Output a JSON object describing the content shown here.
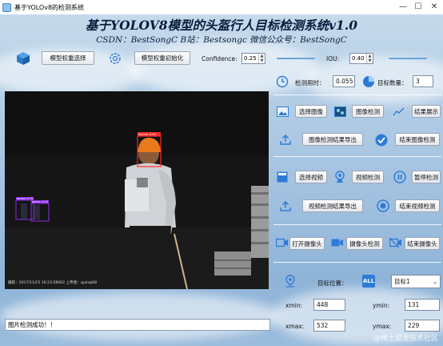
{
  "window": {
    "title": "基于YOLOv8的检测系统"
  },
  "header": {
    "title": "基于YOLOV8模型的头盔行人目标检测系统v1.0",
    "subtitle": "CSDN：BestSongC   B站：Bestsongc   微信公众号：BestSongC"
  },
  "toolbar": {
    "model_select_label": "模型权重选择",
    "model_init_label": "模型权重初始化",
    "confidence_label": "Confidence:",
    "confidence_value": "0.25",
    "iou_label": "IOU:",
    "iou_value": "0.40"
  },
  "stats": {
    "time_label": "检测用时：",
    "time_value": "0.055",
    "count_label": "目标数量：",
    "count_value": "3"
  },
  "image_panel": {
    "select_image": "选择图像",
    "detect_image": "图像检测",
    "show_result": "结果展示",
    "export_image": "图像检测结果导出",
    "stop_image": "结束图像检测"
  },
  "video_panel": {
    "select_video": "选择视频",
    "detect_video": "视频检测",
    "pause_detect": "暂停检测",
    "export_video": "视频检测结果导出",
    "stop_video": "结束视频检测"
  },
  "camera_panel": {
    "open_camera": "打开摄像头",
    "detect_camera": "摄像头检测",
    "stop_camera": "结束摄像头"
  },
  "target": {
    "position_label": "目标位置：",
    "selected": "目标1",
    "xmin_label": "xmin:",
    "xmin_value": "448",
    "ymin_label": "ymin:",
    "ymin_value": "131",
    "xmax_label": "xmax:",
    "xmax_value": "532",
    "ymax_label": "ymax:",
    "ymax_value": "229"
  },
  "viewer": {
    "detections": [
      "helmet 0.94",
      "person 0.76",
      "person 0.53"
    ],
    "photo_caption": "摄影：2017/11/15 10:23:58002 上传者：quinqi08"
  },
  "status": {
    "message": "图片检测成功！！"
  },
  "footer": {
    "watermark": "@稀土掘金技术社区"
  },
  "colors": {
    "accent": "#2e7bd6",
    "helmet_box": "#ff2a2a",
    "person_box": "#8a2be2"
  }
}
